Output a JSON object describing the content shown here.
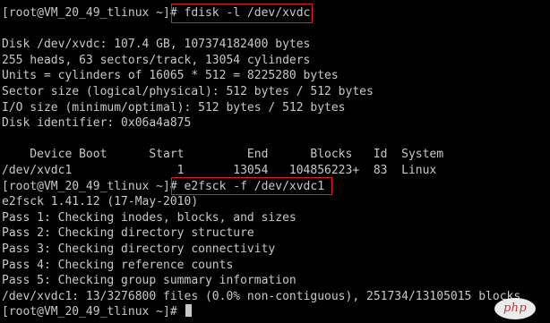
{
  "terminal": {
    "lines": [
      "[root@VM_20_49_tlinux ~]# fdisk -l /dev/xvdc",
      "",
      "Disk /dev/xvdc: 107.4 GB, 107374182400 bytes",
      "255 heads, 63 sectors/track, 13054 cylinders",
      "Units = cylinders of 16065 * 512 = 8225280 bytes",
      "Sector size (logical/physical): 512 bytes / 512 bytes",
      "I/O size (minimum/optimal): 512 bytes / 512 bytes",
      "Disk identifier: 0x06a4a875",
      "",
      "    Device Boot      Start         End      Blocks   Id  System",
      "/dev/xvdc1               1       13054   104856223+  83  Linux",
      "[root@VM_20_49_tlinux ~]# e2fsck -f /dev/xvdc1",
      "e2fsck 1.41.12 (17-May-2010)",
      "Pass 1: Checking inodes, blocks, and sizes",
      "Pass 2: Checking directory structure",
      "Pass 3: Checking directory connectivity",
      "Pass 4: Checking reference counts",
      "Pass 5: Checking group summary information",
      "/dev/xvdc1: 13/3276800 files (0.0% non-contiguous), 251734/13105015 blocks",
      "[root@VM_20_49_tlinux ~]# "
    ]
  },
  "watermark": {
    "text": "php"
  },
  "colors": {
    "background": "#000000",
    "text": "#c8c8c8",
    "highlight_border": "#e02020",
    "watermark_text": "#c0392b"
  }
}
